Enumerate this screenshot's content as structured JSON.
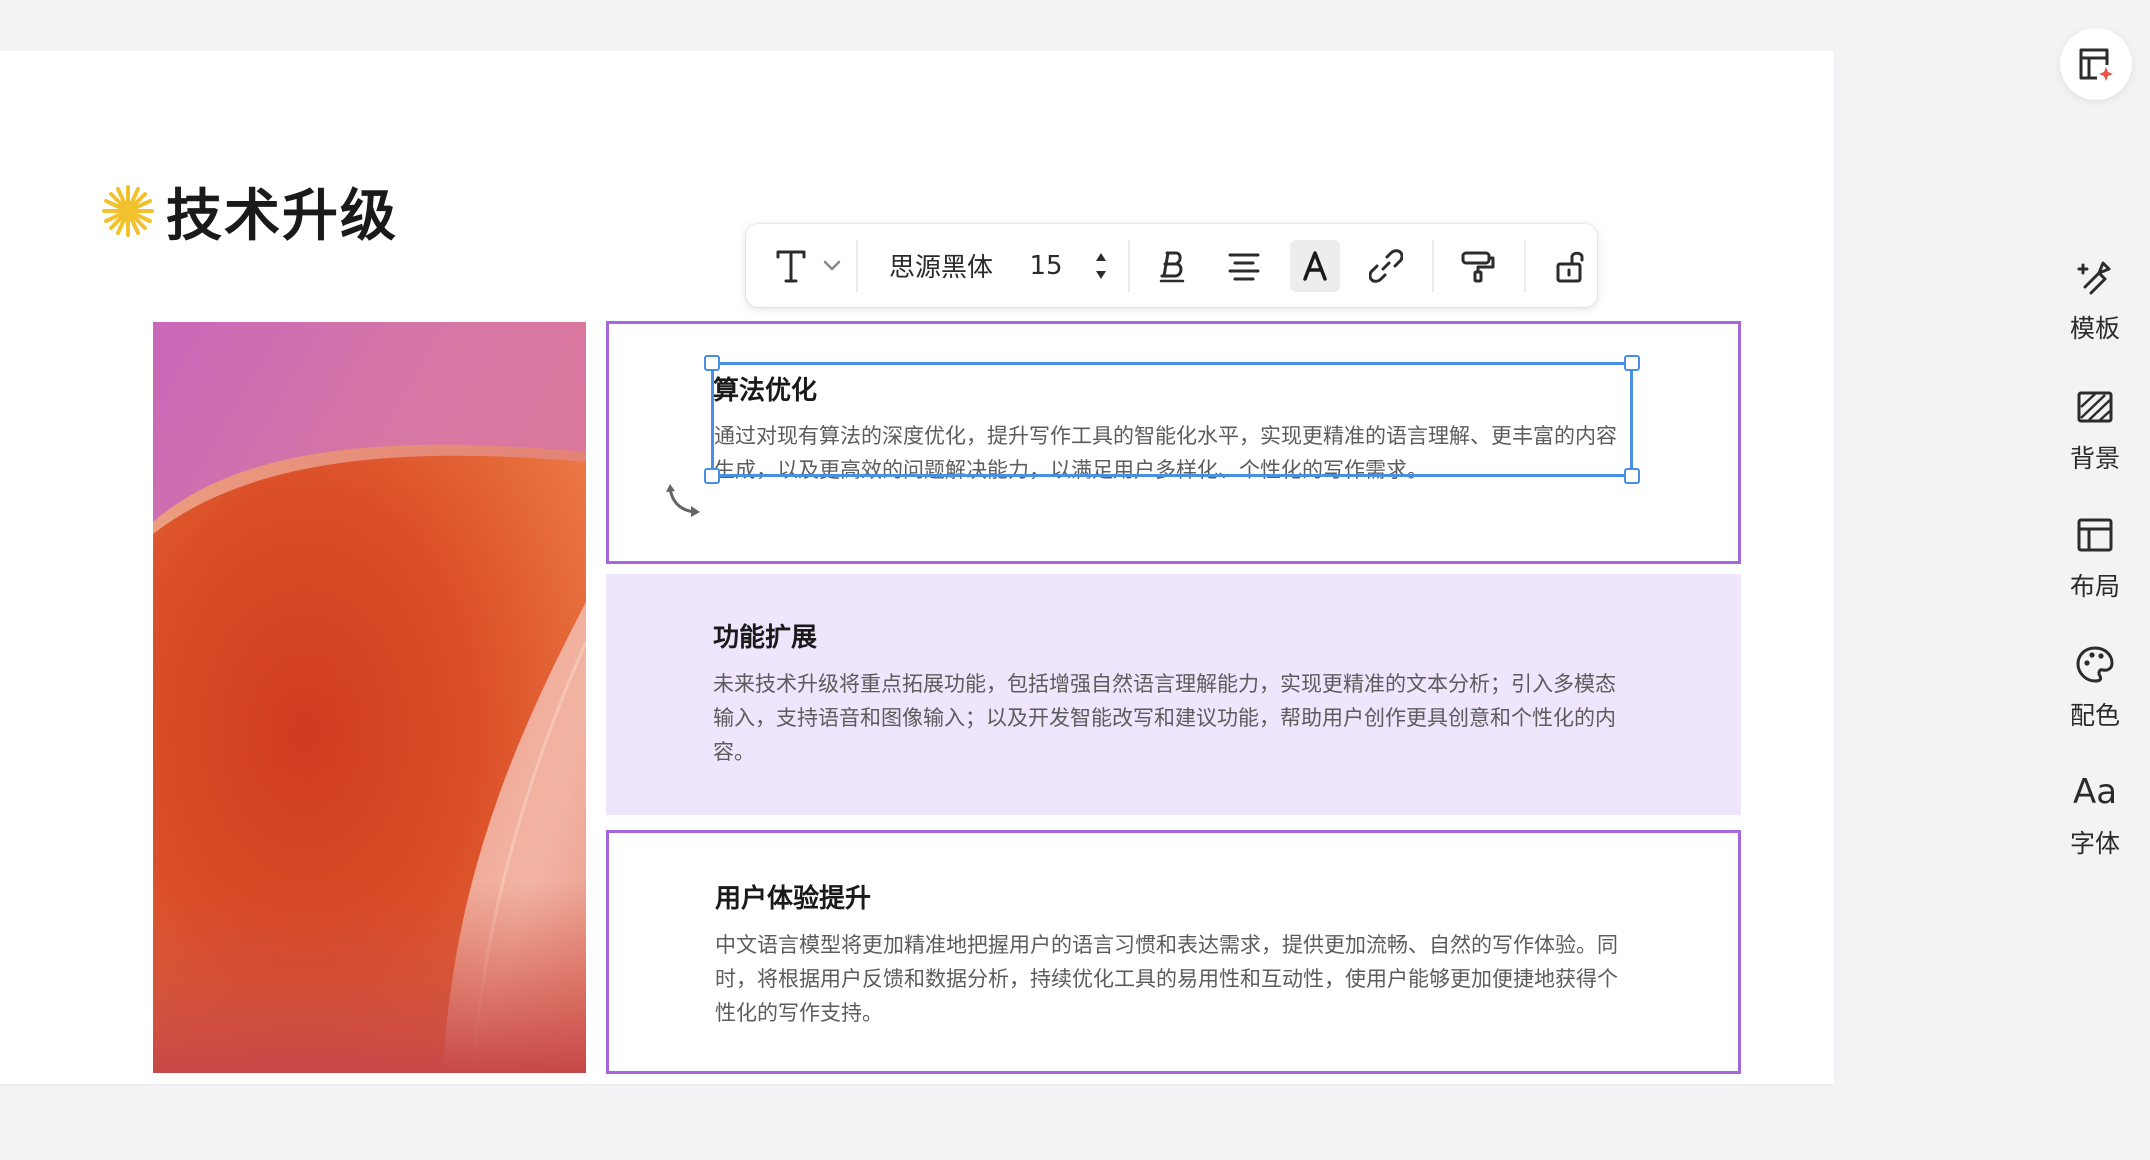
{
  "slide": {
    "title": "技术升级",
    "cards": [
      {
        "heading": "算法优化",
        "body": "通过对现有算法的深度优化，提升写作工具的智能化水平，实现更精准的语言理解、更丰富的内容生成，以及更高效的问题解决能力，以满足用户多样化、个性化的写作需求。"
      },
      {
        "heading": "功能扩展",
        "body": "未来技术升级将重点拓展功能，包括增强自然语言理解能力，实现更精准的文本分析；引入多模态输入，支持语音和图像输入；以及开发智能改写和建议功能，帮助用户创作更具创意和个性化的内容。"
      },
      {
        "heading": "用户体验提升",
        "body": "中文语言模型将更加精准地把握用户的语言习惯和表达需求，提供更加流畅、自然的写作体验。同时，将根据用户反馈和数据分析，持续优化工具的易用性和互动性，使用户能够更加便捷地获得个性化的写作支持。"
      }
    ]
  },
  "toolbar": {
    "font_family": "思源黑体",
    "font_size": "15",
    "buttons": [
      "text-style",
      "font-family",
      "font-size",
      "bold",
      "align",
      "text-color",
      "link",
      "format-painter",
      "lock"
    ]
  },
  "sidebar": {
    "items": [
      {
        "label": "模板",
        "icon": "template-icon"
      },
      {
        "label": "背景",
        "icon": "background-icon"
      },
      {
        "label": "布局",
        "icon": "layout-icon"
      },
      {
        "label": "配色",
        "icon": "palette-icon"
      },
      {
        "label": "字体",
        "icon": "font-icon",
        "glyph": "Aa"
      }
    ]
  },
  "colors": {
    "accent_purple": "#a667dd",
    "card_fill": "#efe5fc",
    "selection_blue": "#4a90e2",
    "star_yellow": "#f2c12e"
  }
}
